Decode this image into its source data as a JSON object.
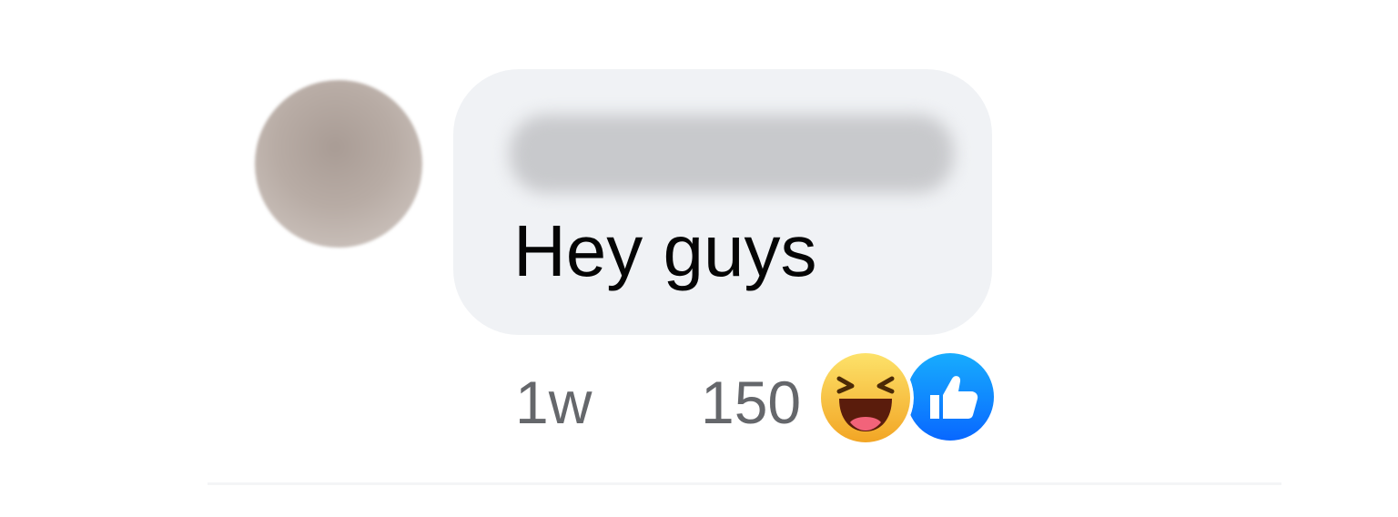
{
  "comment": {
    "author_name": "",
    "text": "Hey guys",
    "timestamp": "1w",
    "reaction_count": "150",
    "reactions": [
      "haha-reaction-icon",
      "like-reaction-icon"
    ]
  },
  "colors": {
    "bubble": "#f0f2f5",
    "text": "#050505",
    "meta_text": "#65676b",
    "like_blue": "#1877f2",
    "haha_yellow": "#f7b125"
  }
}
